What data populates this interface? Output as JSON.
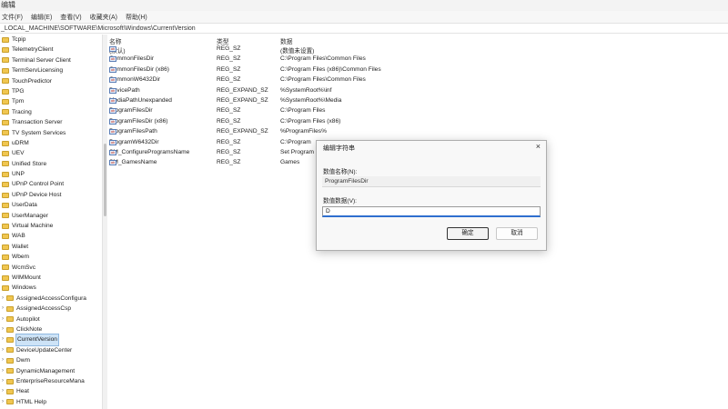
{
  "window": {
    "title": "编辑"
  },
  "menu": [
    "文件(F)",
    "编辑(E)",
    "查看(V)",
    "收藏夹(A)",
    "帮助(H)"
  ],
  "address": "_LOCAL_MACHINE\\SOFTWARE\\Microsoft\\Windows\\CurrentVersion",
  "tree": [
    {
      "label": "Tcpip",
      "child": false
    },
    {
      "label": "TelemetryClient",
      "child": false
    },
    {
      "label": "Terminal Server Client",
      "child": false
    },
    {
      "label": "TermServLicensing",
      "child": false
    },
    {
      "label": "TouchPredictor",
      "child": false
    },
    {
      "label": "TPG",
      "child": false
    },
    {
      "label": "Tpm",
      "child": false
    },
    {
      "label": "Tracing",
      "child": false
    },
    {
      "label": "Transaction Server",
      "child": false
    },
    {
      "label": "TV System Services",
      "child": false
    },
    {
      "label": "uDRM",
      "child": false
    },
    {
      "label": "UEV",
      "child": false
    },
    {
      "label": "Unified Store",
      "child": false
    },
    {
      "label": "UNP",
      "child": false
    },
    {
      "label": "UPnP Control Point",
      "child": false
    },
    {
      "label": "UPnP Device Host",
      "child": false
    },
    {
      "label": "UserData",
      "child": false
    },
    {
      "label": "UserManager",
      "child": false
    },
    {
      "label": "Virtual Machine",
      "child": false
    },
    {
      "label": "WAB",
      "child": false
    },
    {
      "label": "Wallet",
      "child": false
    },
    {
      "label": "Wbem",
      "child": false
    },
    {
      "label": "WcmSvc",
      "child": false
    },
    {
      "label": "WIMMount",
      "child": false
    },
    {
      "label": "Windows",
      "child": false
    },
    {
      "label": "AssignedAccessConfigura",
      "child": true
    },
    {
      "label": "AssignedAccessCsp",
      "child": true
    },
    {
      "label": "Autopilot",
      "child": true
    },
    {
      "label": "ClickNote",
      "child": true
    },
    {
      "label": "CurrentVersion",
      "child": true,
      "selected": true
    },
    {
      "label": "DeviceUpdateCenter",
      "child": true
    },
    {
      "label": "Dwm",
      "child": true
    },
    {
      "label": "DynamicManagement",
      "child": true
    },
    {
      "label": "EnterpriseResourceMana",
      "child": true
    },
    {
      "label": "Heat",
      "child": true
    },
    {
      "label": "HTML Help",
      "child": true
    }
  ],
  "columns": {
    "name": "名称",
    "type": "类型",
    "data": "数据"
  },
  "values": [
    {
      "name": "(默认)",
      "type": "REG_SZ",
      "data": "(数值未设置)"
    },
    {
      "name": "CommonFilesDir",
      "type": "REG_SZ",
      "data": "C:\\Program Files\\Common Files"
    },
    {
      "name": "CommonFilesDir (x86)",
      "type": "REG_SZ",
      "data": "C:\\Program Files (x86)\\Common Files"
    },
    {
      "name": "CommonW6432Dir",
      "type": "REG_SZ",
      "data": "C:\\Program Files\\Common Files"
    },
    {
      "name": "DevicePath",
      "type": "REG_EXPAND_SZ",
      "data": "%SystemRoot%\\inf"
    },
    {
      "name": "MediaPathUnexpanded",
      "type": "REG_EXPAND_SZ",
      "data": "%SystemRoot%\\Media"
    },
    {
      "name": "ProgramFilesDir",
      "type": "REG_SZ",
      "data": "C:\\Program Files"
    },
    {
      "name": "ProgramFilesDir (x86)",
      "type": "REG_SZ",
      "data": "C:\\Program Files (x86)"
    },
    {
      "name": "ProgramFilesPath",
      "type": "REG_EXPAND_SZ",
      "data": "%ProgramFiles%"
    },
    {
      "name": "ProgramW6432Dir",
      "type": "REG_SZ",
      "data": "C:\\Program"
    },
    {
      "name": "SM_ConfigureProgramsName",
      "type": "REG_SZ",
      "data": "Set Program"
    },
    {
      "name": "SM_GamesName",
      "type": "REG_SZ",
      "data": "Games"
    }
  ],
  "dialog": {
    "title": "编辑字符串",
    "close": "×",
    "name_label": "数值名称(N):",
    "name_value": "ProgramFilesDir",
    "data_label": "数值数据(V):",
    "data_value": "D",
    "ok": "确定",
    "cancel": "取消"
  }
}
